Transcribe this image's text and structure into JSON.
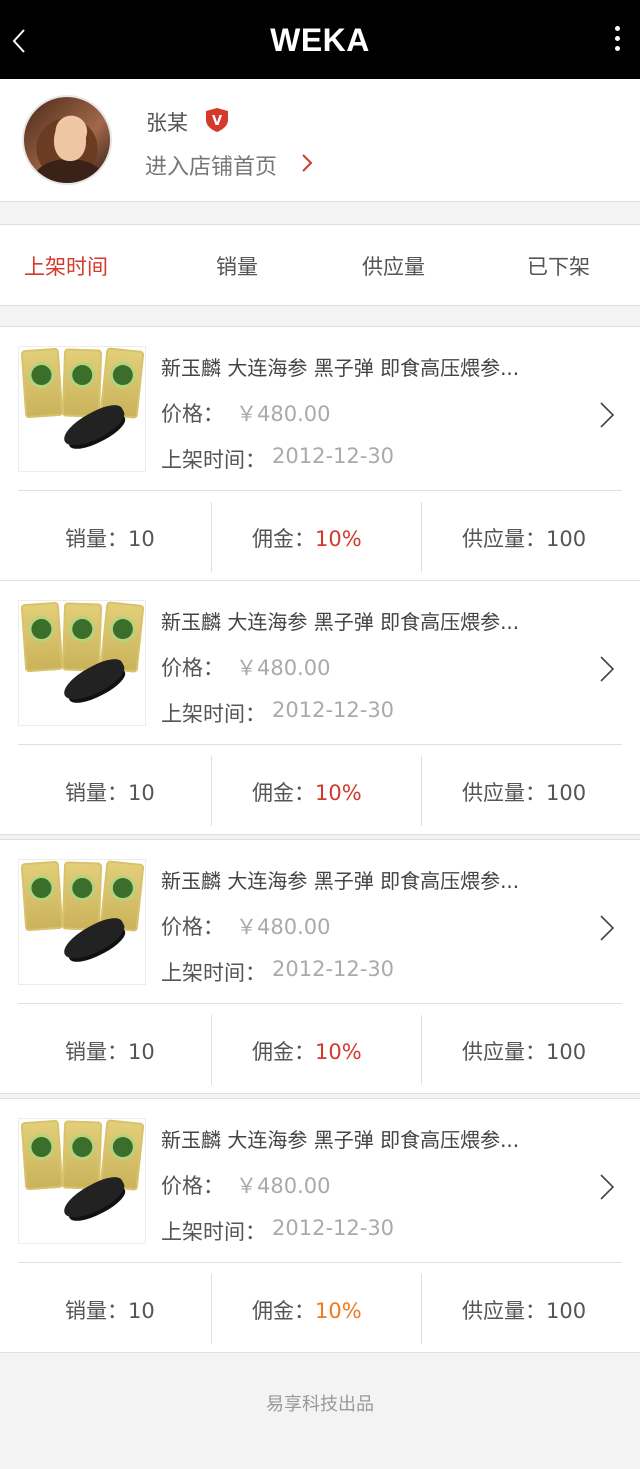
{
  "header": {
    "title": "WEKA",
    "back_icon": "chevron-left-icon",
    "more_icon": "more-vertical-icon",
    "background": "#000000"
  },
  "profile": {
    "name": "张某",
    "badge_text": "V",
    "badge_color": "#d33a2c",
    "store_link": "进入店铺首页"
  },
  "tabs": [
    {
      "label": "上架时间",
      "active": true
    },
    {
      "label": "销量",
      "active": false
    },
    {
      "label": "供应量",
      "active": false
    },
    {
      "label": "已下架",
      "active": false
    }
  ],
  "products": [
    {
      "title": "新玉麟 大连海参 黑子弹 即食高压煨参...",
      "price_label": "价格：",
      "price": "￥480.00",
      "date_label": "上架时间：",
      "date": "2012-12-30",
      "sales_label": "销量：",
      "sales": "10",
      "commission_label": "佣金：",
      "commission": "10%",
      "supply_label": "供应量：",
      "supply": "100"
    },
    {
      "title": "新玉麟 大连海参 黑子弹 即食高压煨参...",
      "price_label": "价格：",
      "price": "￥480.00",
      "date_label": "上架时间：",
      "date": "2012-12-30",
      "sales_label": "销量：",
      "sales": "10",
      "commission_label": "佣金：",
      "commission": "10%",
      "supply_label": "供应量：",
      "supply": "100"
    },
    {
      "title": "新玉麟 大连海参 黑子弹 即食高压煨参...",
      "price_label": "价格：",
      "price": "￥480.00",
      "date_label": "上架时间：",
      "date": "2012-12-30",
      "sales_label": "销量：",
      "sales": "10",
      "commission_label": "佣金：",
      "commission": "10%",
      "supply_label": "供应量：",
      "supply": "100"
    },
    {
      "title": "新玉麟 大连海参 黑子弹 即食高压煨参...",
      "price_label": "价格：",
      "price": "￥480.00",
      "date_label": "上架时间：",
      "date": "2012-12-30",
      "sales_label": "销量：",
      "sales": "10",
      "commission_label": "佣金：",
      "commission": "10%",
      "supply_label": "供应量：",
      "supply": "100"
    }
  ],
  "colors": {
    "accent": "#d33a2c",
    "commission_last": "#f07a1e"
  },
  "footer": {
    "text": "易享科技出品"
  }
}
